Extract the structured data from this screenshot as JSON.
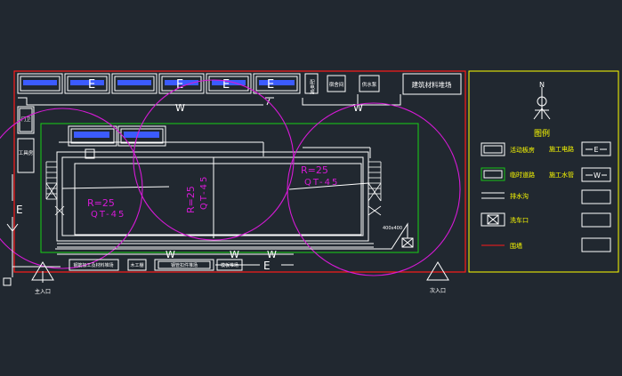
{
  "colors": {
    "background": "#212830",
    "boundary": "#ff1a1a",
    "road": "#19c319",
    "white": "#ffffff",
    "crane": "#d61ad6",
    "yellow": "#ffff00",
    "text_blue": "#3b5bff"
  },
  "top_buildings": {
    "e_marks": [
      "E",
      "E",
      "E",
      "E"
    ],
    "small_rooms": [
      "配电房",
      "宿舍间",
      "供水泵"
    ],
    "material_yard": "建筑材料堆场"
  },
  "left_rooms": [
    "门卫",
    "工具房"
  ],
  "pipe_marks": {
    "water_top_left": "W",
    "water_top_right": "W",
    "water_bottom": [
      "W",
      "W",
      "W"
    ],
    "elec_left": "E",
    "elec_bottom": "E"
  },
  "cranes": [
    {
      "radius": "R=25",
      "model": "QT-45"
    },
    {
      "radius": "R=25",
      "model": "QT-45"
    },
    {
      "radius": "R=25",
      "model": "QT-45"
    }
  ],
  "bottom_buildings": [
    "钢筋加工及材料堆场",
    "木工棚",
    "钢管扣件堆场",
    "模板堆场"
  ],
  "small_tag": "400x400",
  "entrances": {
    "main": "主入口",
    "secondary": "次入口"
  },
  "legend": {
    "title": "图例",
    "north": "N",
    "items": [
      {
        "label": "活动板房",
        "mark_label": "施工电路",
        "mark_symbol": "E"
      },
      {
        "label": "临时道路",
        "mark_label": "施工水管",
        "mark_symbol": "W"
      },
      {
        "label": "排水沟",
        "mark_label": "",
        "mark_symbol": ""
      },
      {
        "label": "洗车口",
        "mark_label": "",
        "mark_symbol": ""
      },
      {
        "label": "围墙",
        "mark_label": "",
        "mark_symbol": ""
      }
    ]
  }
}
